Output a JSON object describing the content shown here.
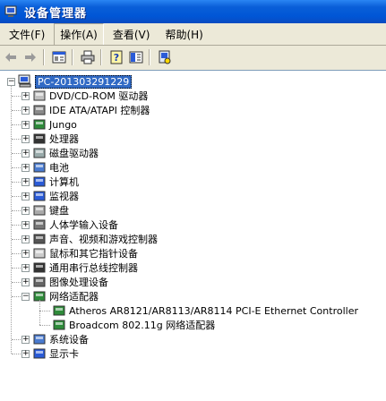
{
  "window": {
    "title": "设备管理器"
  },
  "menu": [
    {
      "label": "文件(F)"
    },
    {
      "label": "操作(A)"
    },
    {
      "label": "查看(V)"
    },
    {
      "label": "帮助(H)"
    }
  ],
  "toolbar": {
    "buttons": [
      "back-icon",
      "forward-icon",
      "properties-icon",
      "print-icon",
      "help-icon",
      "view-icon",
      "scan-hardware-icon"
    ]
  },
  "tree": {
    "root": "PC-201303291229",
    "categories": [
      {
        "label": "DVD/CD-ROM 驱动器",
        "icon": "dvd-drive-icon",
        "expanded": false
      },
      {
        "label": "IDE ATA/ATAPI 控制器",
        "icon": "ide-controller-icon",
        "expanded": false
      },
      {
        "label": "Jungo",
        "icon": "jungo-icon",
        "expanded": false
      },
      {
        "label": "处理器",
        "icon": "processor-icon",
        "expanded": false
      },
      {
        "label": "磁盘驱动器",
        "icon": "disk-drive-icon",
        "expanded": false
      },
      {
        "label": "电池",
        "icon": "battery-icon",
        "expanded": false
      },
      {
        "label": "计算机",
        "icon": "computer-icon",
        "expanded": false
      },
      {
        "label": "监视器",
        "icon": "monitor-icon",
        "expanded": false
      },
      {
        "label": "键盘",
        "icon": "keyboard-icon",
        "expanded": false
      },
      {
        "label": "人体学输入设备",
        "icon": "hid-icon",
        "expanded": false
      },
      {
        "label": "声音、视频和游戏控制器",
        "icon": "sound-icon",
        "expanded": false
      },
      {
        "label": "鼠标和其它指针设备",
        "icon": "mouse-icon",
        "expanded": false
      },
      {
        "label": "通用串行总线控制器",
        "icon": "usb-icon",
        "expanded": false
      },
      {
        "label": "图像处理设备",
        "icon": "imaging-icon",
        "expanded": false
      },
      {
        "label": "网络适配器",
        "icon": "network-adapter-icon",
        "expanded": true,
        "children": [
          {
            "label": "Atheros AR8121/AR8113/AR8114 PCI-E Ethernet Controller"
          },
          {
            "label": "Broadcom 802.11g 网络适配器"
          }
        ]
      },
      {
        "label": "系统设备",
        "icon": "system-device-icon",
        "expanded": false
      },
      {
        "label": "显示卡",
        "icon": "display-adapter-icon",
        "expanded": false
      }
    ]
  }
}
